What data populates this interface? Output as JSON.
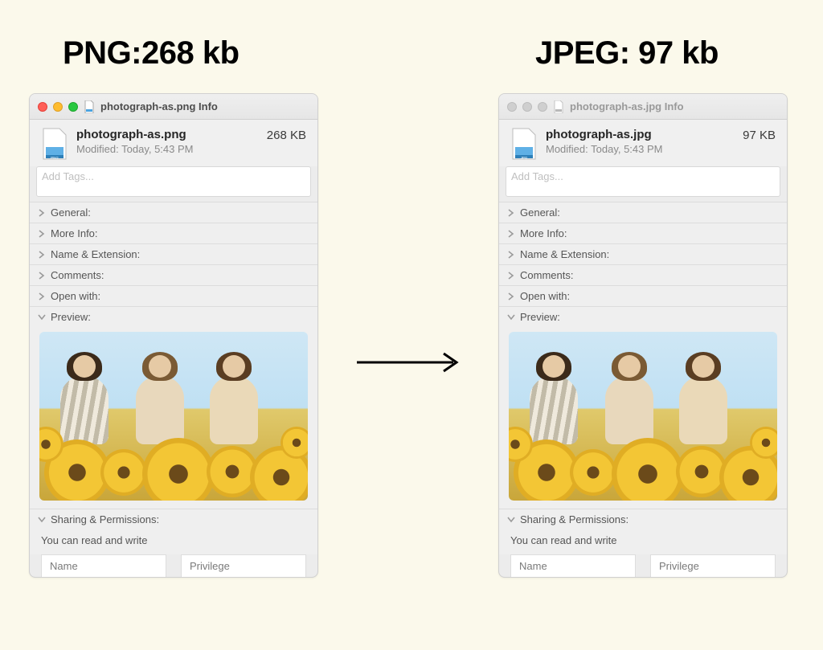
{
  "headings": {
    "left": "PNG:268 kb",
    "right": "JPEG: 97 kb"
  },
  "panels": [
    {
      "id": "left",
      "active": true,
      "window_title": "photograph-as.png Info",
      "file_icon_badge": "PNG",
      "filename": "photograph-as.png",
      "modified": "Modified: Today, 5:43 PM",
      "size": "268 KB",
      "tags_placeholder": "Add Tags...",
      "sections": [
        {
          "label": "General:",
          "open": false
        },
        {
          "label": "More Info:",
          "open": false
        },
        {
          "label": "Name & Extension:",
          "open": false
        },
        {
          "label": "Comments:",
          "open": false
        },
        {
          "label": "Open with:",
          "open": false
        },
        {
          "label": "Preview:",
          "open": true
        }
      ],
      "sharing": {
        "header": "Sharing & Permissions:",
        "subtext": "You can read and write",
        "cols": [
          "Name",
          "Privilege"
        ]
      }
    },
    {
      "id": "right",
      "active": false,
      "window_title": "photograph-as.jpg Info",
      "file_icon_badge": "JPG",
      "filename": "photograph-as.jpg",
      "modified": "Modified: Today, 5:43 PM",
      "size": "97 KB",
      "tags_placeholder": "Add Tags...",
      "sections": [
        {
          "label": "General:",
          "open": false
        },
        {
          "label": "More Info:",
          "open": false
        },
        {
          "label": "Name & Extension:",
          "open": false
        },
        {
          "label": "Comments:",
          "open": false
        },
        {
          "label": "Open with:",
          "open": false
        },
        {
          "label": "Preview:",
          "open": true
        }
      ],
      "sharing": {
        "header": "Sharing & Permissions:",
        "subtext": "You can read and write",
        "cols": [
          "Name",
          "Privilege"
        ]
      }
    }
  ]
}
